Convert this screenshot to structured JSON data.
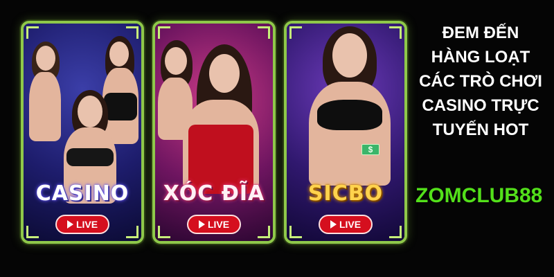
{
  "cards": [
    {
      "title": "CASINO",
      "live_label": "LIVE",
      "icon": "play-icon"
    },
    {
      "title": "XÓC ĐĨA",
      "live_label": "LIVE",
      "icon": "play-icon"
    },
    {
      "title": "SICBO",
      "live_label": "LIVE",
      "icon": "play-icon"
    }
  ],
  "headline": [
    "ĐEM ĐẾN",
    "HÀNG LOẠT",
    "CÁC TRÒ CHƠI",
    "CASINO TRỰC",
    "TUYẾN HOT"
  ],
  "brand": "ZOMCLUB88",
  "cash_symbol": "$",
  "colors": {
    "frame": "#8fc84a",
    "live_button": "#d50f1e",
    "brand": "#53e01a"
  }
}
